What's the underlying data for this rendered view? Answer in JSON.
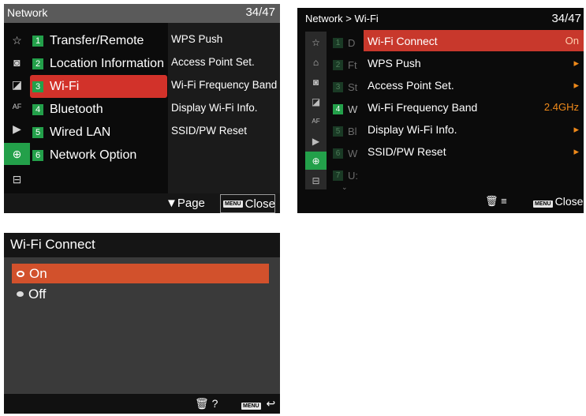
{
  "screen1": {
    "title": "Network",
    "page": "34/47",
    "icons": [
      "star-icon",
      "camera-search-icon",
      "exposure-icon",
      "af-mf-icon",
      "playback-icon",
      "network-globe-icon",
      "toolbox-icon"
    ],
    "items": [
      {
        "num": "1",
        "label": "Transfer/Remote"
      },
      {
        "num": "2",
        "label": "Location Information"
      },
      {
        "num": "3",
        "label": "Wi-Fi"
      },
      {
        "num": "4",
        "label": "Bluetooth"
      },
      {
        "num": "5",
        "label": "Wired LAN"
      },
      {
        "num": "6",
        "label": "Network Option"
      }
    ],
    "submenu": [
      "WPS Push",
      "Access Point Set.",
      "Wi-Fi Frequency Band",
      "Display Wi-Fi Info.",
      "SSID/PW Reset"
    ],
    "footer": {
      "page_label": "Page",
      "close_label": "Close",
      "menu_key": "MENU"
    }
  },
  "screen2": {
    "title": "Network > Wi-Fi",
    "page": "34/47",
    "middle": [
      {
        "num": "1",
        "letter": "D"
      },
      {
        "num": "2",
        "letter": "Ft"
      },
      {
        "num": "3",
        "letter": "St"
      },
      {
        "num": "4",
        "letter": "W"
      },
      {
        "num": "5",
        "letter": "Bl"
      },
      {
        "num": "6",
        "letter": "W"
      },
      {
        "num": "7",
        "letter": "U:"
      }
    ],
    "items": [
      {
        "label": "Wi-Fi Connect",
        "value": "On"
      },
      {
        "label": "WPS Push",
        "value": "▸"
      },
      {
        "label": "Access Point Set.",
        "value": "▸"
      },
      {
        "label": "Wi-Fi Frequency Band",
        "value": "2.4GHz"
      },
      {
        "label": "Display Wi-Fi Info.",
        "value": "▸"
      },
      {
        "label": "SSID/PW Reset",
        "value": "▸"
      }
    ],
    "footer": {
      "close_label": "Close",
      "menu_key": "MENU"
    }
  },
  "screen3": {
    "title": "Wi-Fi Connect",
    "options": [
      "On",
      "Off"
    ],
    "footer": {
      "help": "?",
      "menu_key": "MENU",
      "back": "↩"
    }
  },
  "colors": {
    "accent_red": "#d2322a",
    "menu_green": "#23a04a",
    "value_orange": "#f08a1a"
  }
}
